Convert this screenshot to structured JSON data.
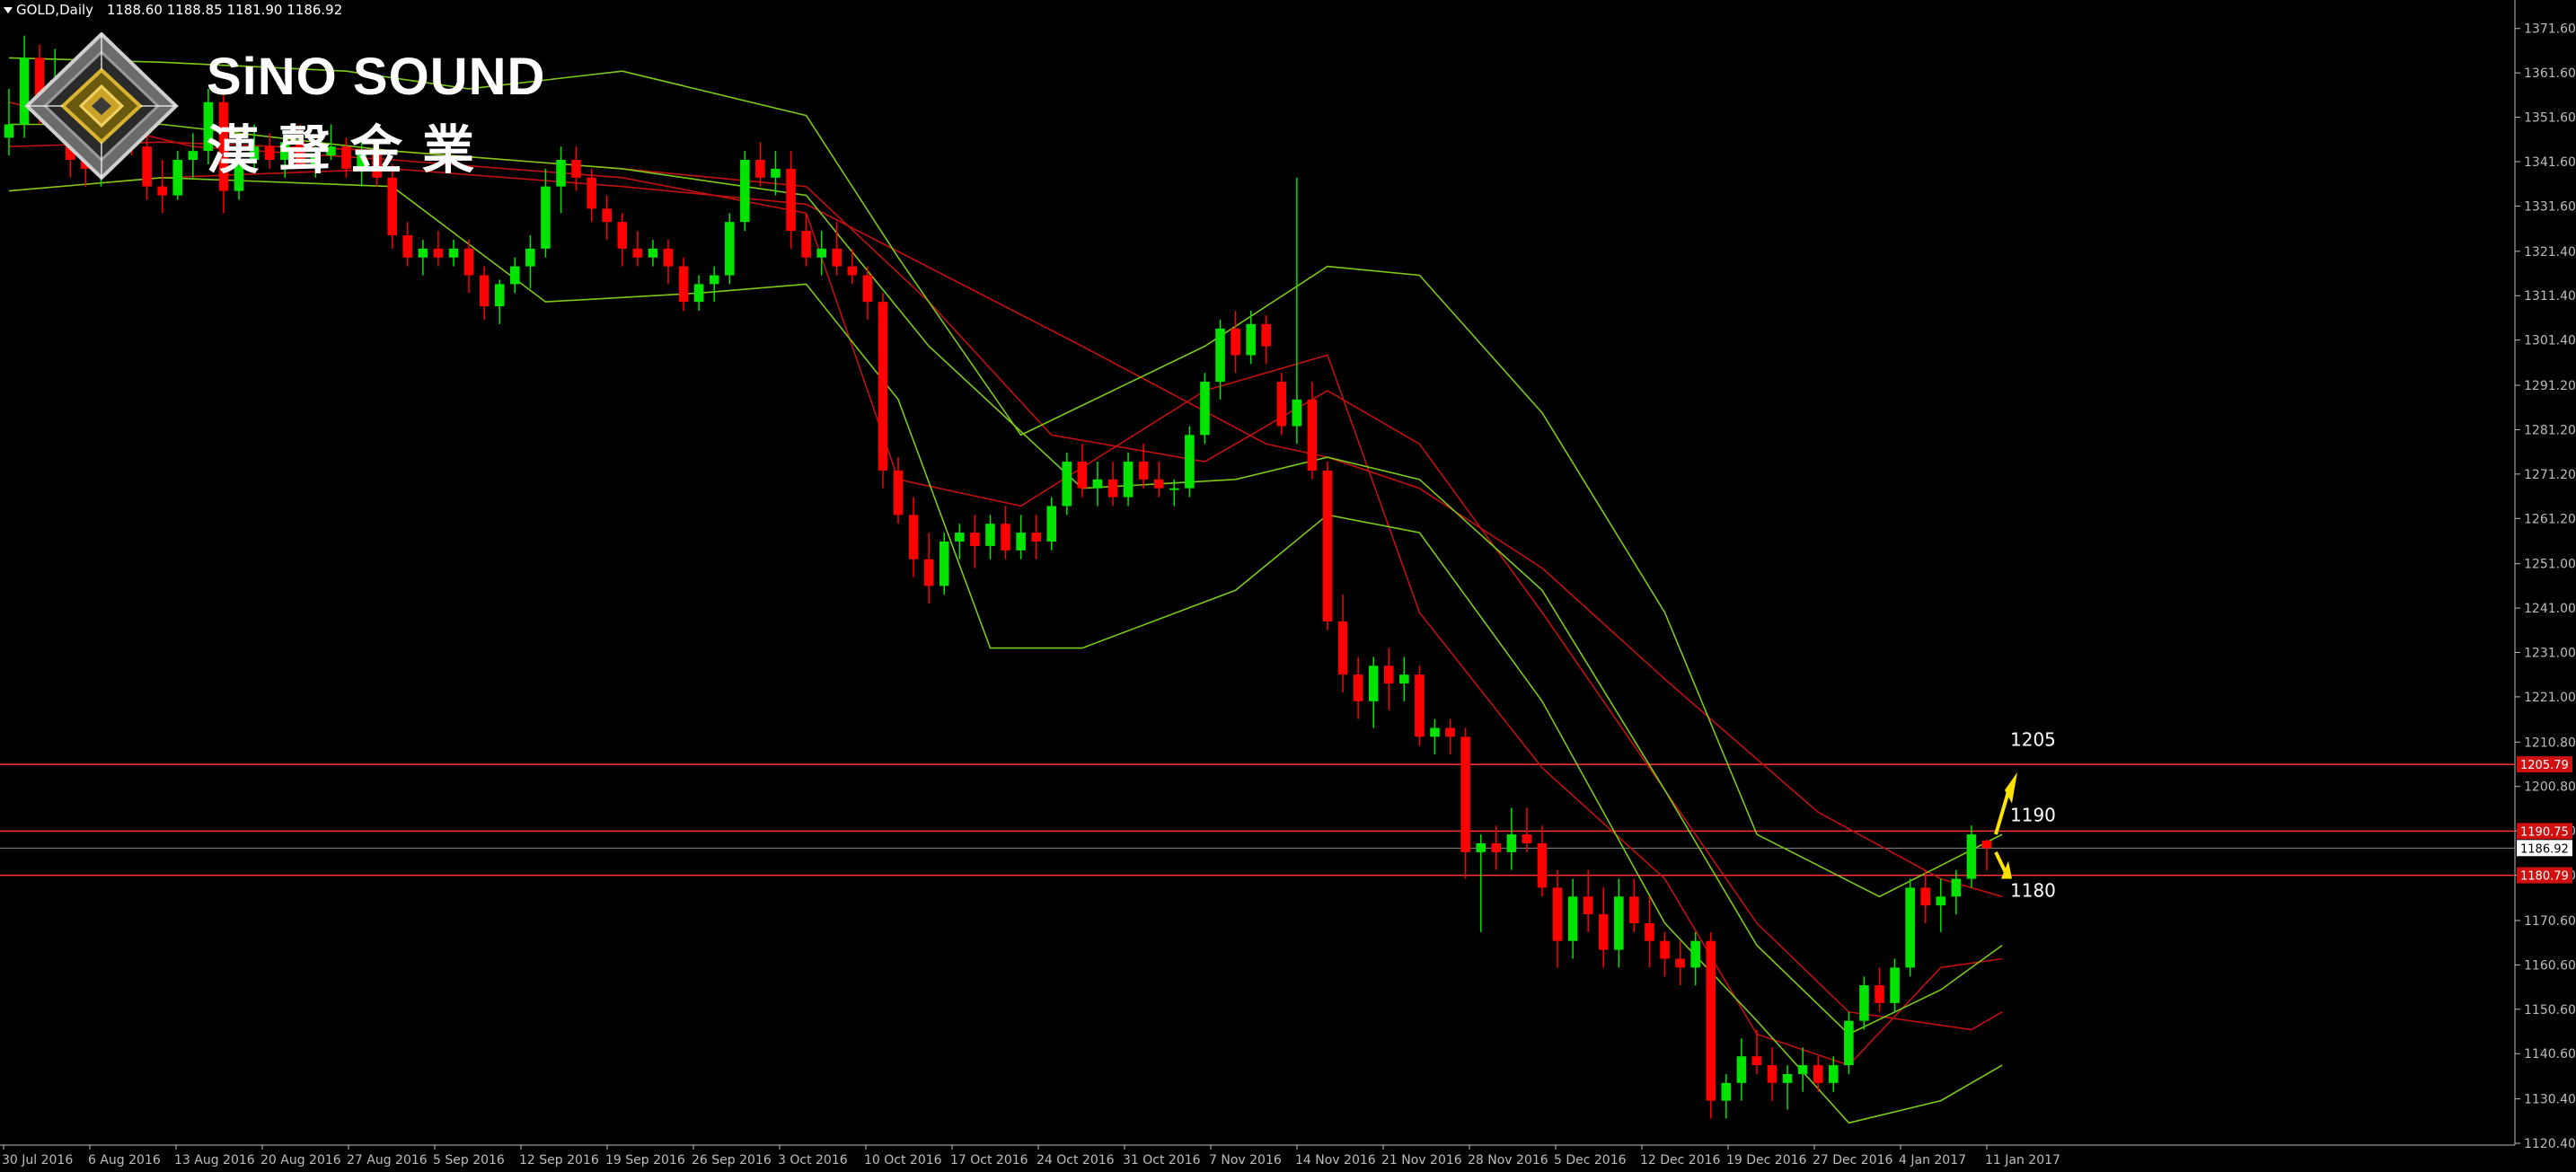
{
  "header": {
    "symbol": "GOLD,Daily",
    "ohlc": "1188.60 1188.85 1181.90 1186.92"
  },
  "logo": {
    "brand_en": "SiNO SOUND",
    "brand_zh": "漢聲金業"
  },
  "chart_data": {
    "type": "candlestick",
    "instrument": "GOLD",
    "timeframe": "Daily",
    "ylim": [
      1120,
      1376
    ],
    "y_ticks": [
      "1371.60",
      "1361.60",
      "1351.60",
      "1341.60",
      "1331.60",
      "1321.40",
      "1311.40",
      "1301.40",
      "1291.20",
      "1281.20",
      "1271.20",
      "1261.20",
      "1251.00",
      "1241.00",
      "1231.00",
      "1221.00",
      "1210.80",
      "1200.80",
      "1190.80",
      "1180.80",
      "1170.60",
      "1160.60",
      "1150.60",
      "1140.60",
      "1130.40",
      "1120.40"
    ],
    "x_ticks": [
      "30 Jul 2016",
      "6 Aug 2016",
      "13 Aug 2016",
      "20 Aug 2016",
      "27 Aug 2016",
      "5 Sep 2016",
      "12 Sep 2016",
      "19 Sep 2016",
      "26 Sep 2016",
      "3 Oct 2016",
      "10 Oct 2016",
      "17 Oct 2016",
      "24 Oct 2016",
      "31 Oct 2016",
      "7 Nov 2016",
      "14 Nov 2016",
      "21 Nov 2016",
      "28 Nov 2016",
      "5 Dec 2016",
      "12 Dec 2016",
      "19 Dec 2016",
      "27 Dec 2016",
      "4 Jan 2017",
      "11 Jan 2017"
    ],
    "current_price": "1186.92",
    "price_boxes": [
      {
        "value": 1205.79,
        "text": "1205.79"
      },
      {
        "value": 1190.75,
        "text": "1190.75"
      },
      {
        "value": 1180.79,
        "text": "1180.79"
      }
    ],
    "levels": [
      {
        "value": 1205,
        "label": "1205"
      },
      {
        "value": 1190,
        "label": "1190"
      },
      {
        "value": 1180,
        "label": "1180"
      }
    ],
    "candles": [
      [
        1347,
        1358,
        1343,
        1350
      ],
      [
        1350,
        1370,
        1347,
        1365
      ],
      [
        1365,
        1368,
        1350,
        1355
      ],
      [
        1355,
        1367,
        1352,
        1360
      ],
      [
        1360,
        1364,
        1338,
        1342
      ],
      [
        1342,
        1350,
        1336,
        1340
      ],
      [
        1340,
        1348,
        1336,
        1345
      ],
      [
        1345,
        1352,
        1342,
        1350
      ],
      [
        1350,
        1354,
        1343,
        1345
      ],
      [
        1345,
        1350,
        1333,
        1336
      ],
      [
        1336,
        1342,
        1330,
        1334
      ],
      [
        1334,
        1344,
        1333,
        1342
      ],
      [
        1342,
        1348,
        1338,
        1344
      ],
      [
        1344,
        1358,
        1341,
        1355
      ],
      [
        1355,
        1357,
        1330,
        1335
      ],
      [
        1335,
        1344,
        1333,
        1342
      ],
      [
        1342,
        1350,
        1340,
        1345
      ],
      [
        1345,
        1348,
        1340,
        1342
      ],
      [
        1342,
        1348,
        1338,
        1346
      ],
      [
        1346,
        1350,
        1340,
        1341
      ],
      [
        1341,
        1345,
        1338,
        1343
      ],
      [
        1343,
        1350,
        1342,
        1345
      ],
      [
        1345,
        1347,
        1338,
        1340
      ],
      [
        1340,
        1346,
        1336,
        1344
      ],
      [
        1344,
        1345,
        1336,
        1338
      ],
      [
        1338,
        1341,
        1322,
        1325
      ],
      [
        1325,
        1328,
        1318,
        1320
      ],
      [
        1320,
        1324,
        1316,
        1322
      ],
      [
        1322,
        1326,
        1318,
        1320
      ],
      [
        1320,
        1324,
        1318,
        1322
      ],
      [
        1322,
        1324,
        1312,
        1316
      ],
      [
        1316,
        1318,
        1306,
        1309
      ],
      [
        1309,
        1315,
        1305,
        1314
      ],
      [
        1314,
        1320,
        1312,
        1318
      ],
      [
        1318,
        1325,
        1313,
        1322
      ],
      [
        1322,
        1340,
        1320,
        1336
      ],
      [
        1336,
        1345,
        1330,
        1342
      ],
      [
        1342,
        1345,
        1335,
        1338
      ],
      [
        1338,
        1340,
        1328,
        1331
      ],
      [
        1331,
        1334,
        1324,
        1328
      ],
      [
        1328,
        1330,
        1318,
        1322
      ],
      [
        1322,
        1326,
        1318,
        1320
      ],
      [
        1320,
        1324,
        1318,
        1322
      ],
      [
        1322,
        1324,
        1314,
        1318
      ],
      [
        1318,
        1320,
        1308,
        1310
      ],
      [
        1310,
        1316,
        1308,
        1314
      ],
      [
        1314,
        1318,
        1310,
        1316
      ],
      [
        1316,
        1330,
        1314,
        1328
      ],
      [
        1328,
        1344,
        1326,
        1342
      ],
      [
        1342,
        1346,
        1336,
        1338
      ],
      [
        1338,
        1344,
        1334,
        1340
      ],
      [
        1340,
        1344,
        1322,
        1326
      ],
      [
        1326,
        1330,
        1318,
        1320
      ],
      [
        1320,
        1326,
        1316,
        1322
      ],
      [
        1322,
        1328,
        1316,
        1318
      ],
      [
        1318,
        1322,
        1314,
        1316
      ],
      [
        1316,
        1318,
        1306,
        1310
      ],
      [
        1310,
        1312,
        1268,
        1272
      ],
      [
        1272,
        1275,
        1260,
        1262
      ],
      [
        1262,
        1266,
        1248,
        1252
      ],
      [
        1252,
        1258,
        1242,
        1246
      ],
      [
        1246,
        1258,
        1244,
        1256
      ],
      [
        1256,
        1260,
        1252,
        1258
      ],
      [
        1258,
        1262,
        1250,
        1255
      ],
      [
        1255,
        1262,
        1252,
        1260
      ],
      [
        1260,
        1264,
        1252,
        1254
      ],
      [
        1254,
        1262,
        1252,
        1258
      ],
      [
        1258,
        1262,
        1252,
        1256
      ],
      [
        1256,
        1266,
        1254,
        1264
      ],
      [
        1264,
        1276,
        1262,
        1274
      ],
      [
        1274,
        1278,
        1266,
        1268
      ],
      [
        1268,
        1274,
        1264,
        1270
      ],
      [
        1270,
        1274,
        1264,
        1266
      ],
      [
        1266,
        1276,
        1264,
        1274
      ],
      [
        1274,
        1278,
        1268,
        1270
      ],
      [
        1270,
        1274,
        1266,
        1268
      ],
      [
        1268,
        1270,
        1264,
        1268
      ],
      [
        1268,
        1282,
        1266,
        1280
      ],
      [
        1280,
        1294,
        1278,
        1292
      ],
      [
        1292,
        1306,
        1288,
        1304
      ],
      [
        1304,
        1308,
        1294,
        1298
      ],
      [
        1298,
        1308,
        1296,
        1305
      ],
      [
        1305,
        1307,
        1296,
        1300
      ],
      [
        1292,
        1294,
        1280,
        1282
      ],
      [
        1282,
        1338,
        1278,
        1288
      ],
      [
        1288,
        1292,
        1270,
        1272
      ],
      [
        1272,
        1274,
        1236,
        1238
      ],
      [
        1238,
        1244,
        1222,
        1226
      ],
      [
        1226,
        1230,
        1216,
        1220
      ],
      [
        1220,
        1230,
        1214,
        1228
      ],
      [
        1228,
        1232,
        1218,
        1224
      ],
      [
        1224,
        1230,
        1220,
        1226
      ],
      [
        1226,
        1228,
        1210,
        1212
      ],
      [
        1212,
        1216,
        1208,
        1214
      ],
      [
        1214,
        1216,
        1208,
        1212
      ],
      [
        1212,
        1214,
        1180,
        1186
      ],
      [
        1186,
        1190,
        1168,
        1188
      ],
      [
        1188,
        1192,
        1182,
        1186
      ],
      [
        1186,
        1196,
        1182,
        1190
      ],
      [
        1190,
        1196,
        1186,
        1188
      ],
      [
        1188,
        1192,
        1176,
        1178
      ],
      [
        1178,
        1182,
        1160,
        1166
      ],
      [
        1166,
        1180,
        1162,
        1176
      ],
      [
        1176,
        1182,
        1168,
        1172
      ],
      [
        1172,
        1178,
        1160,
        1164
      ],
      [
        1164,
        1180,
        1160,
        1176
      ],
      [
        1176,
        1180,
        1168,
        1170
      ],
      [
        1170,
        1176,
        1160,
        1166
      ],
      [
        1166,
        1168,
        1158,
        1162
      ],
      [
        1162,
        1166,
        1156,
        1160
      ],
      [
        1160,
        1168,
        1156,
        1166
      ],
      [
        1166,
        1168,
        1126,
        1130
      ],
      [
        1130,
        1136,
        1126,
        1134
      ],
      [
        1134,
        1144,
        1130,
        1140
      ],
      [
        1140,
        1146,
        1136,
        1138
      ],
      [
        1138,
        1142,
        1130,
        1134
      ],
      [
        1134,
        1138,
        1128,
        1136
      ],
      [
        1136,
        1142,
        1132,
        1138
      ],
      [
        1138,
        1140,
        1132,
        1134
      ],
      [
        1134,
        1140,
        1132,
        1138
      ],
      [
        1138,
        1150,
        1136,
        1148
      ],
      [
        1148,
        1158,
        1146,
        1156
      ],
      [
        1156,
        1160,
        1150,
        1152
      ],
      [
        1152,
        1162,
        1150,
        1160
      ],
      [
        1160,
        1180,
        1158,
        1178
      ],
      [
        1178,
        1182,
        1170,
        1174
      ],
      [
        1174,
        1180,
        1168,
        1176
      ],
      [
        1176,
        1182,
        1172,
        1180
      ],
      [
        1180,
        1192,
        1178,
        1190
      ],
      [
        1188.6,
        1188.85,
        1181.9,
        1186.92
      ]
    ],
    "overlays": [
      {
        "name": "",
        "color": "#c0100f",
        "values": [
          [
            0,
            1335
          ],
          [
            10,
            1338
          ],
          [
            25,
            1340
          ],
          [
            40,
            1336
          ],
          [
            52,
            1332
          ],
          [
            70,
            1300
          ],
          [
            82,
            1278
          ],
          [
            86,
            1275
          ],
          [
            92,
            1268
          ],
          [
            100,
            1250
          ],
          [
            108,
            1225
          ],
          [
            118,
            1195
          ],
          [
            126,
            1180
          ],
          [
            130,
            1176
          ]
        ]
      },
      {
        "name": "",
        "color": "#c0100f",
        "values": [
          [
            0,
            1345
          ],
          [
            10,
            1346
          ],
          [
            25,
            1344
          ],
          [
            40,
            1340
          ],
          [
            52,
            1336
          ],
          [
            60,
            1310
          ],
          [
            68,
            1280
          ],
          [
            78,
            1274
          ],
          [
            86,
            1290
          ],
          [
            92,
            1278
          ],
          [
            100,
            1240
          ],
          [
            108,
            1200
          ],
          [
            114,
            1170
          ],
          [
            120,
            1150
          ],
          [
            128,
            1146
          ],
          [
            130,
            1150
          ]
        ]
      },
      {
        "name": "",
        "color": "#c0100f",
        "values": [
          [
            0,
            1355
          ],
          [
            12,
            1345
          ],
          [
            25,
            1342
          ],
          [
            40,
            1338
          ],
          [
            52,
            1330
          ],
          [
            58,
            1270
          ],
          [
            66,
            1264
          ],
          [
            78,
            1290
          ],
          [
            86,
            1298
          ],
          [
            92,
            1240
          ],
          [
            100,
            1205
          ],
          [
            108,
            1180
          ],
          [
            114,
            1145
          ],
          [
            120,
            1138
          ],
          [
            126,
            1160
          ],
          [
            130,
            1162
          ]
        ]
      },
      {
        "name": "",
        "color": "#7cc91a",
        "values": [
          [
            0,
            1365
          ],
          [
            10,
            1364
          ],
          [
            22,
            1362
          ],
          [
            30,
            1358
          ],
          [
            40,
            1362
          ],
          [
            52,
            1352
          ],
          [
            58,
            1320
          ],
          [
            66,
            1280
          ],
          [
            78,
            1300
          ],
          [
            86,
            1318
          ],
          [
            92,
            1316
          ],
          [
            100,
            1285
          ],
          [
            108,
            1240
          ],
          [
            114,
            1190
          ],
          [
            122,
            1176
          ],
          [
            130,
            1190
          ]
        ]
      },
      {
        "name": "",
        "color": "#7cc91a",
        "values": [
          [
            0,
            1350
          ],
          [
            10,
            1350
          ],
          [
            25,
            1344
          ],
          [
            40,
            1340
          ],
          [
            52,
            1334
          ],
          [
            60,
            1300
          ],
          [
            70,
            1268
          ],
          [
            80,
            1270
          ],
          [
            86,
            1275
          ],
          [
            92,
            1270
          ],
          [
            100,
            1245
          ],
          [
            108,
            1200
          ],
          [
            114,
            1165
          ],
          [
            120,
            1145
          ],
          [
            126,
            1155
          ],
          [
            130,
            1165
          ]
        ]
      },
      {
        "name": "",
        "color": "#7cc91a",
        "values": [
          [
            0,
            1335
          ],
          [
            10,
            1338
          ],
          [
            25,
            1336
          ],
          [
            35,
            1310
          ],
          [
            45,
            1312
          ],
          [
            52,
            1314
          ],
          [
            58,
            1288
          ],
          [
            64,
            1232
          ],
          [
            70,
            1232
          ],
          [
            80,
            1245
          ],
          [
            86,
            1262
          ],
          [
            92,
            1258
          ],
          [
            100,
            1220
          ],
          [
            108,
            1170
          ],
          [
            114,
            1148
          ],
          [
            120,
            1125
          ],
          [
            126,
            1130
          ],
          [
            130,
            1138
          ]
        ]
      }
    ]
  },
  "colors": {
    "up": "#00e400",
    "down": "#ff0000",
    "band": "#7cc91a",
    "ma": "#c0100f",
    "level": "#ff3333",
    "arrow": "#ffe400",
    "axis": "#bcbcbc"
  }
}
